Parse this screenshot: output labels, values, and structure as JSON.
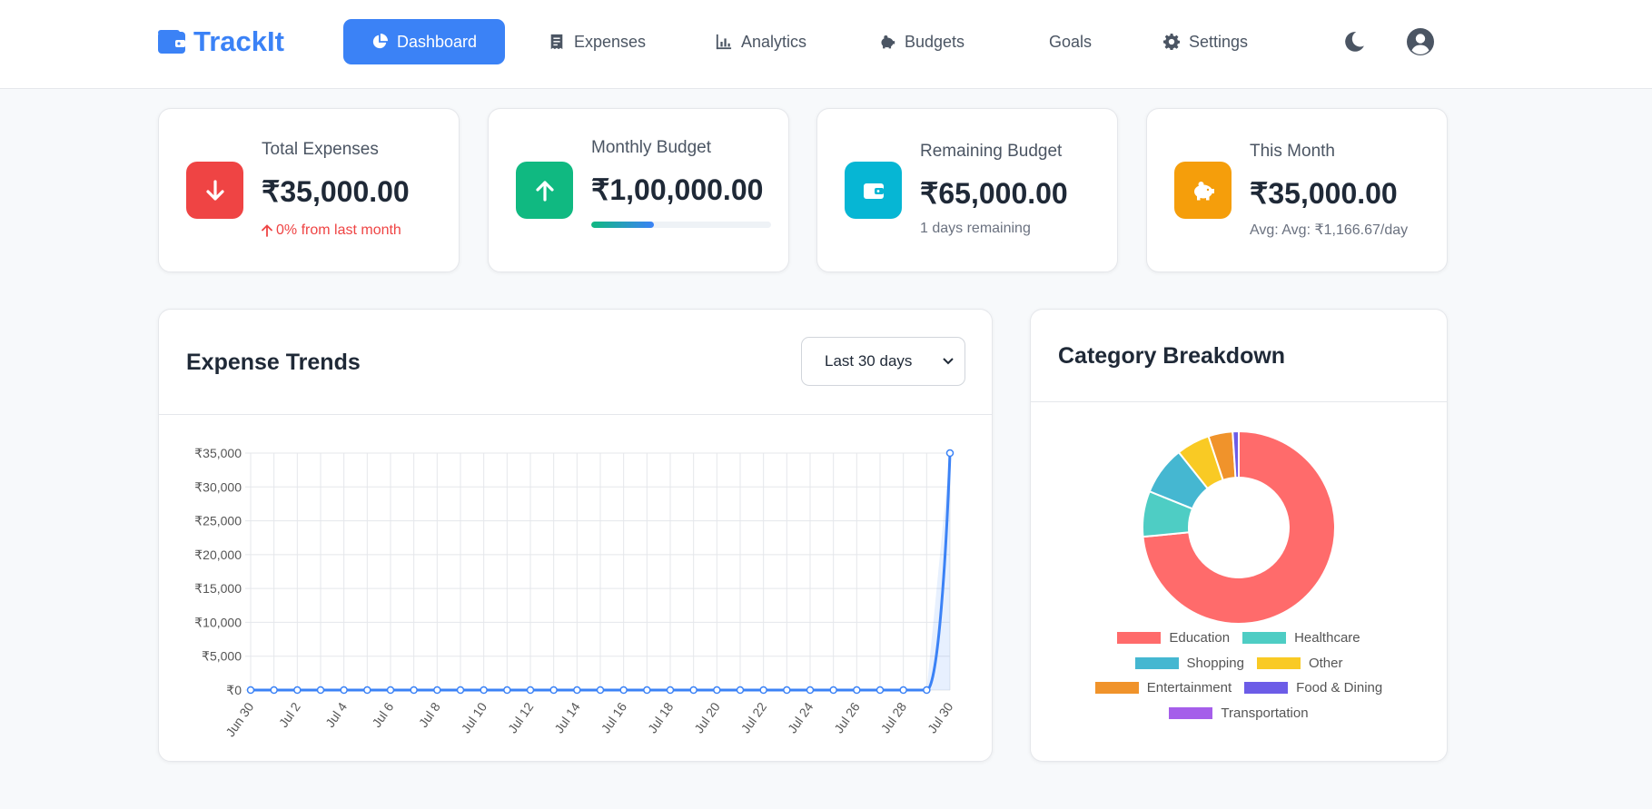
{
  "app": {
    "brand": "TrackIt"
  },
  "nav": {
    "items": [
      {
        "label": "Dashboard",
        "icon": "pie-chart-icon",
        "active": true
      },
      {
        "label": "Expenses",
        "icon": "receipt-icon",
        "active": false
      },
      {
        "label": "Analytics",
        "icon": "bar-chart-icon",
        "active": false
      },
      {
        "label": "Budgets",
        "icon": "piggy-bank-icon",
        "active": false
      },
      {
        "label": "Goals",
        "icon": "",
        "active": false
      },
      {
        "label": "Settings",
        "icon": "gear-icon",
        "active": false
      }
    ],
    "theme_toggle_icon": "moon-icon",
    "profile_icon": "user-circle-icon"
  },
  "stats": [
    {
      "label": "Total Expenses",
      "value": "₹35,000.00",
      "sub": "0% from last month",
      "icon": "arrow-down-icon",
      "color": "#ef4444"
    },
    {
      "label": "Monthly Budget",
      "value": "₹1,00,000.00",
      "progress": 0.35,
      "icon": "arrow-up-icon",
      "color": "#10b981"
    },
    {
      "label": "Remaining Budget",
      "value": "₹65,000.00",
      "sub": "1 days remaining",
      "icon": "wallet-icon",
      "color": "#06b6d4"
    },
    {
      "label": "This Month",
      "value": "₹35,000.00",
      "sub": "Avg: Avg: ₹1,166.67/day",
      "icon": "piggy-bank-icon",
      "color": "#f59e0b"
    }
  ],
  "trends": {
    "title": "Expense Trends",
    "range_selected": "Last 30 days"
  },
  "breakdown": {
    "title": "Category Breakdown"
  },
  "chart_data": [
    {
      "type": "line",
      "title": "Expense Trends",
      "x_tick_labels": [
        "Jun 30",
        "Jul 2",
        "Jul 4",
        "Jul 6",
        "Jul 8",
        "Jul 10",
        "Jul 12",
        "Jul 14",
        "Jul 16",
        "Jul 18",
        "Jul 20",
        "Jul 22",
        "Jul 24",
        "Jul 26",
        "Jul 28",
        "Jul 30"
      ],
      "x": [
        "Jun 30",
        "Jul 1",
        "Jul 2",
        "Jul 3",
        "Jul 4",
        "Jul 5",
        "Jul 6",
        "Jul 7",
        "Jul 8",
        "Jul 9",
        "Jul 10",
        "Jul 11",
        "Jul 12",
        "Jul 13",
        "Jul 14",
        "Jul 15",
        "Jul 16",
        "Jul 17",
        "Jul 18",
        "Jul 19",
        "Jul 20",
        "Jul 21",
        "Jul 22",
        "Jul 23",
        "Jul 24",
        "Jul 25",
        "Jul 26",
        "Jul 27",
        "Jul 28",
        "Jul 29",
        "Jul 30"
      ],
      "values": [
        0,
        0,
        0,
        0,
        0,
        0,
        0,
        0,
        0,
        0,
        0,
        0,
        0,
        0,
        0,
        0,
        0,
        0,
        0,
        0,
        0,
        0,
        0,
        0,
        0,
        0,
        0,
        0,
        0,
        0,
        35000
      ],
      "y_tick_labels": [
        "₹0",
        "₹5,000",
        "₹10,000",
        "₹15,000",
        "₹20,000",
        "₹25,000",
        "₹30,000",
        "₹35,000"
      ],
      "ylim": [
        0,
        35000
      ],
      "grid": true,
      "color": "#3b82f6"
    },
    {
      "type": "pie",
      "title": "Category Breakdown",
      "legend_position": "bottom",
      "slices": [
        {
          "name": "Education",
          "value": 72,
          "color": "#ff6b6b"
        },
        {
          "name": "Healthcare",
          "value": 7.5,
          "color": "#4ecdc4"
        },
        {
          "name": "Shopping",
          "value": 8,
          "color": "#45b7d1"
        },
        {
          "name": "Other",
          "value": 5.5,
          "color": "#f9ca24"
        },
        {
          "name": "Entertainment",
          "value": 4,
          "color": "#f0932b"
        },
        {
          "name": "Food & Dining",
          "value": 1,
          "color": "#6c5ce7"
        },
        {
          "name": "Transportation",
          "value": 0,
          "color": "#a55eea"
        }
      ]
    }
  ]
}
